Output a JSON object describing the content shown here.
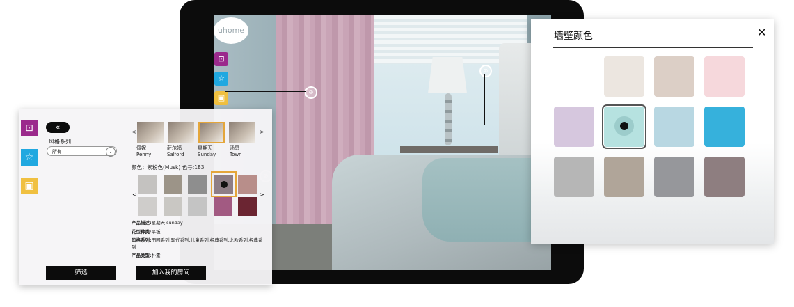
{
  "tablet": {
    "logo_text": "uhome",
    "icons": [
      {
        "name": "room-icon",
        "color": "#9b2a8c",
        "glyph": "⊡"
      },
      {
        "name": "star-icon",
        "color": "#20a8e0",
        "glyph": "☆"
      },
      {
        "name": "image-icon",
        "color": "#f0c040",
        "glyph": "▣"
      }
    ],
    "pin_glyph": "⊘"
  },
  "left_panel": {
    "side_icons": [
      {
        "name": "room-icon",
        "color": "#9b2a8c",
        "glyph": "⊡"
      },
      {
        "name": "star-icon",
        "color": "#20a8e0",
        "glyph": "☆"
      },
      {
        "name": "image-icon",
        "color": "#f0c040",
        "glyph": "▣"
      }
    ],
    "back_glyph": "«",
    "style_label": "风格系列",
    "style_select_value": "所有",
    "prev_arrow": "<",
    "next_arrow": ">",
    "rooms": [
      {
        "cn": "佩妮",
        "en": "Penny"
      },
      {
        "cn": "萨尔福",
        "en": "Salford"
      },
      {
        "cn": "星期天",
        "en": "Sunday"
      },
      {
        "cn": "汤恩",
        "en": "Town"
      }
    ],
    "color_text": "颜色：紫粉色(Musk) 色号:183",
    "swatch_colors": [
      "#c4c2c0",
      "#9c9488",
      "#8e8e8e",
      "#8e7e86",
      "#b88e8a",
      "#cfcdcb",
      "#c9c7c3",
      "#c4c4c4",
      "#a25a82",
      "#6b2532"
    ],
    "info": [
      {
        "label": "产品描述:",
        "value": "星期天 sunday"
      },
      {
        "label": "花型种类:",
        "value": "平板"
      },
      {
        "label": "风格系列:",
        "value": "田园系列,现代系列,儿童系列,经典系列,北欧系列,经典系"
      },
      {
        "label": "",
        "value": "列"
      },
      {
        "label": "产品类型:",
        "value": "朴素"
      }
    ],
    "filter_button": "筛选",
    "add_button": "加入我的房间"
  },
  "right_panel": {
    "title": "墙壁颜色",
    "close_glyph": "✕",
    "swatch_colors": [
      "#ffffff",
      "#ece6e0",
      "#dccfc6",
      "#f6d8dc",
      "#d6c7de",
      "#b6e2e0",
      "#b8d7e2",
      "#36b1dc",
      "#b6b6b6",
      "#b0a599",
      "#96979b",
      "#8e7e80"
    ]
  }
}
